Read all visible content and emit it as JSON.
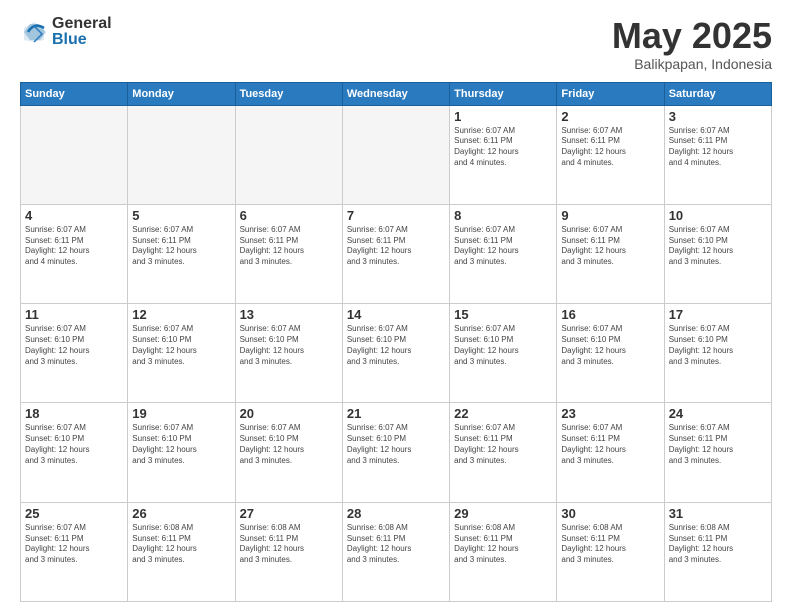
{
  "logo": {
    "general": "General",
    "blue": "Blue"
  },
  "title": "May 2025",
  "location": "Balikpapan, Indonesia",
  "weekdays": [
    "Sunday",
    "Monday",
    "Tuesday",
    "Wednesday",
    "Thursday",
    "Friday",
    "Saturday"
  ],
  "weeks": [
    [
      {
        "day": "",
        "info": ""
      },
      {
        "day": "",
        "info": ""
      },
      {
        "day": "",
        "info": ""
      },
      {
        "day": "",
        "info": ""
      },
      {
        "day": "1",
        "info": "Sunrise: 6:07 AM\nSunset: 6:11 PM\nDaylight: 12 hours\nand 4 minutes."
      },
      {
        "day": "2",
        "info": "Sunrise: 6:07 AM\nSunset: 6:11 PM\nDaylight: 12 hours\nand 4 minutes."
      },
      {
        "day": "3",
        "info": "Sunrise: 6:07 AM\nSunset: 6:11 PM\nDaylight: 12 hours\nand 4 minutes."
      }
    ],
    [
      {
        "day": "4",
        "info": "Sunrise: 6:07 AM\nSunset: 6:11 PM\nDaylight: 12 hours\nand 4 minutes."
      },
      {
        "day": "5",
        "info": "Sunrise: 6:07 AM\nSunset: 6:11 PM\nDaylight: 12 hours\nand 3 minutes."
      },
      {
        "day": "6",
        "info": "Sunrise: 6:07 AM\nSunset: 6:11 PM\nDaylight: 12 hours\nand 3 minutes."
      },
      {
        "day": "7",
        "info": "Sunrise: 6:07 AM\nSunset: 6:11 PM\nDaylight: 12 hours\nand 3 minutes."
      },
      {
        "day": "8",
        "info": "Sunrise: 6:07 AM\nSunset: 6:11 PM\nDaylight: 12 hours\nand 3 minutes."
      },
      {
        "day": "9",
        "info": "Sunrise: 6:07 AM\nSunset: 6:11 PM\nDaylight: 12 hours\nand 3 minutes."
      },
      {
        "day": "10",
        "info": "Sunrise: 6:07 AM\nSunset: 6:10 PM\nDaylight: 12 hours\nand 3 minutes."
      }
    ],
    [
      {
        "day": "11",
        "info": "Sunrise: 6:07 AM\nSunset: 6:10 PM\nDaylight: 12 hours\nand 3 minutes."
      },
      {
        "day": "12",
        "info": "Sunrise: 6:07 AM\nSunset: 6:10 PM\nDaylight: 12 hours\nand 3 minutes."
      },
      {
        "day": "13",
        "info": "Sunrise: 6:07 AM\nSunset: 6:10 PM\nDaylight: 12 hours\nand 3 minutes."
      },
      {
        "day": "14",
        "info": "Sunrise: 6:07 AM\nSunset: 6:10 PM\nDaylight: 12 hours\nand 3 minutes."
      },
      {
        "day": "15",
        "info": "Sunrise: 6:07 AM\nSunset: 6:10 PM\nDaylight: 12 hours\nand 3 minutes."
      },
      {
        "day": "16",
        "info": "Sunrise: 6:07 AM\nSunset: 6:10 PM\nDaylight: 12 hours\nand 3 minutes."
      },
      {
        "day": "17",
        "info": "Sunrise: 6:07 AM\nSunset: 6:10 PM\nDaylight: 12 hours\nand 3 minutes."
      }
    ],
    [
      {
        "day": "18",
        "info": "Sunrise: 6:07 AM\nSunset: 6:10 PM\nDaylight: 12 hours\nand 3 minutes."
      },
      {
        "day": "19",
        "info": "Sunrise: 6:07 AM\nSunset: 6:10 PM\nDaylight: 12 hours\nand 3 minutes."
      },
      {
        "day": "20",
        "info": "Sunrise: 6:07 AM\nSunset: 6:10 PM\nDaylight: 12 hours\nand 3 minutes."
      },
      {
        "day": "21",
        "info": "Sunrise: 6:07 AM\nSunset: 6:10 PM\nDaylight: 12 hours\nand 3 minutes."
      },
      {
        "day": "22",
        "info": "Sunrise: 6:07 AM\nSunset: 6:11 PM\nDaylight: 12 hours\nand 3 minutes."
      },
      {
        "day": "23",
        "info": "Sunrise: 6:07 AM\nSunset: 6:11 PM\nDaylight: 12 hours\nand 3 minutes."
      },
      {
        "day": "24",
        "info": "Sunrise: 6:07 AM\nSunset: 6:11 PM\nDaylight: 12 hours\nand 3 minutes."
      }
    ],
    [
      {
        "day": "25",
        "info": "Sunrise: 6:07 AM\nSunset: 6:11 PM\nDaylight: 12 hours\nand 3 minutes."
      },
      {
        "day": "26",
        "info": "Sunrise: 6:08 AM\nSunset: 6:11 PM\nDaylight: 12 hours\nand 3 minutes."
      },
      {
        "day": "27",
        "info": "Sunrise: 6:08 AM\nSunset: 6:11 PM\nDaylight: 12 hours\nand 3 minutes."
      },
      {
        "day": "28",
        "info": "Sunrise: 6:08 AM\nSunset: 6:11 PM\nDaylight: 12 hours\nand 3 minutes."
      },
      {
        "day": "29",
        "info": "Sunrise: 6:08 AM\nSunset: 6:11 PM\nDaylight: 12 hours\nand 3 minutes."
      },
      {
        "day": "30",
        "info": "Sunrise: 6:08 AM\nSunset: 6:11 PM\nDaylight: 12 hours\nand 3 minutes."
      },
      {
        "day": "31",
        "info": "Sunrise: 6:08 AM\nSunset: 6:11 PM\nDaylight: 12 hours\nand 3 minutes."
      }
    ]
  ]
}
